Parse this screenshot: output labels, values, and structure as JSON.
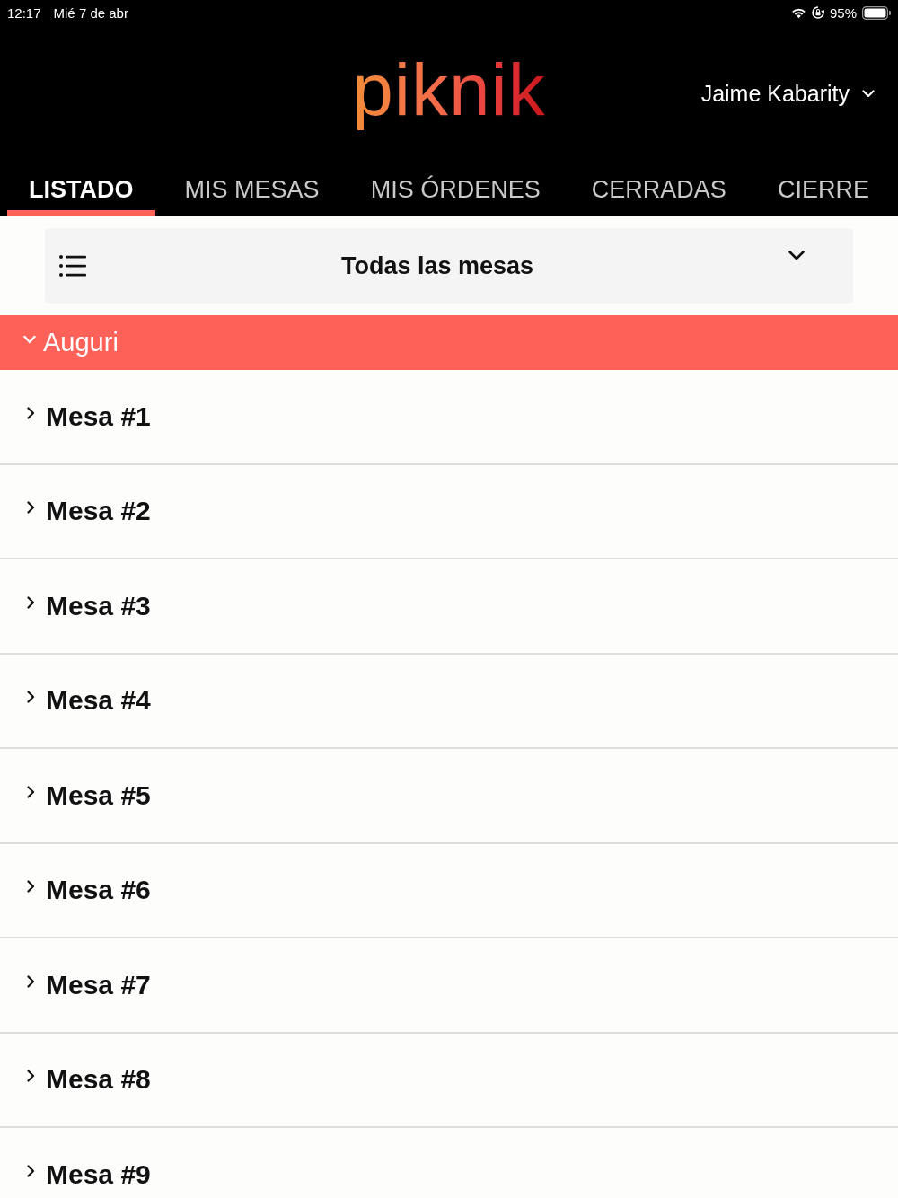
{
  "status_bar": {
    "time": "12:17",
    "date": "Mié 7 de abr",
    "battery": "95%"
  },
  "header": {
    "logo": "piknik",
    "user": "Jaime Kabarity"
  },
  "tabs": [
    {
      "label": "LISTADO",
      "selected": true
    },
    {
      "label": "MIS MESAS",
      "selected": false
    },
    {
      "label": "MIS ÓRDENES",
      "selected": false
    },
    {
      "label": "CERRADAS",
      "selected": false
    },
    {
      "label": "CIERRE",
      "selected": false
    }
  ],
  "filter": {
    "value": "Todas las mesas"
  },
  "groups": [
    {
      "name": "Auguri",
      "expanded": true,
      "tables": [
        {
          "name": "Mesa #1",
          "expanded": false
        },
        {
          "name": "Mesa #2",
          "expanded": false
        },
        {
          "name": "Mesa #3",
          "expanded": false
        },
        {
          "name": "Mesa #4",
          "expanded": false
        },
        {
          "name": "Mesa #5",
          "expanded": false
        },
        {
          "name": "Mesa #6",
          "expanded": false
        },
        {
          "name": "Mesa #7",
          "expanded": false
        },
        {
          "name": "Mesa #8",
          "expanded": false
        },
        {
          "name": "Mesa #9",
          "expanded": false
        }
      ]
    }
  ]
}
